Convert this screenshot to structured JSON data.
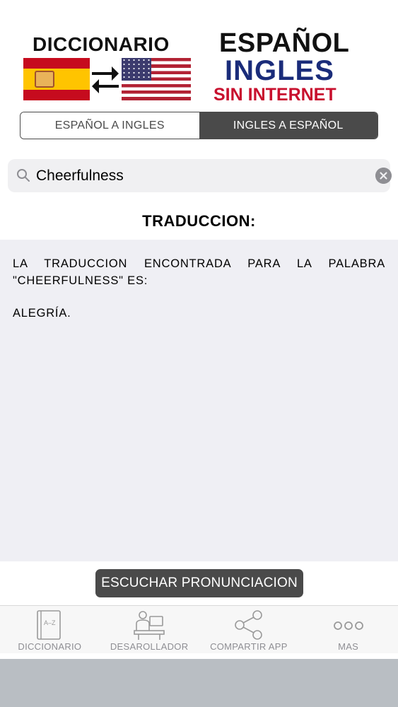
{
  "logo": {
    "left_title": "DICCIONARIO",
    "right_line1": "ESPAÑOL",
    "right_line2": "INGLES",
    "right_line3": "SIN INTERNET",
    "colors": {
      "navy": "#1a2c7a",
      "red": "#c8102e"
    }
  },
  "segmented": {
    "options": [
      "ESPAÑOL A INGLES",
      "INGLES A ESPAÑOL"
    ],
    "selected": "INGLES A ESPAÑOL"
  },
  "search": {
    "value": "Cheerfulness",
    "icon": "search-icon",
    "clear_icon": "clear-icon"
  },
  "translation": {
    "title": "TRADUCCION:",
    "line1": "LA TRADUCCION ENCONTRADA PARA LA PALABRA",
    "line2": "\"CHEERFULNESS\" ES:",
    "result": "ALEGRÍA."
  },
  "pronunciation_button": {
    "label": "ESCUCHAR PRONUNCIACION"
  },
  "tabbar": {
    "items": [
      {
        "label": "DICCIONARIO",
        "icon": "dictionary-book-icon"
      },
      {
        "label": "DESAROLLADOR",
        "icon": "developer-icon"
      },
      {
        "label": "COMPARTIR APP",
        "icon": "share-icon"
      },
      {
        "label": "MAS",
        "icon": "more-dots-icon"
      }
    ]
  },
  "colors": {
    "dark_gray": "#4a4a4a",
    "result_bg": "#efeff4",
    "tab_label": "#8e8e93"
  }
}
